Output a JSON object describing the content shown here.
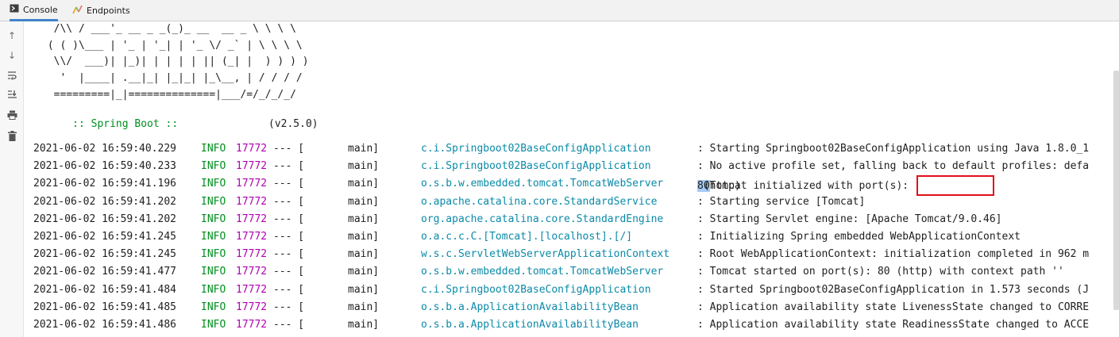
{
  "tabs": [
    {
      "label": "Console",
      "icon": "console-icon",
      "active": true
    },
    {
      "label": "Endpoints",
      "icon": "endpoints-icon",
      "active": false
    }
  ],
  "toolbar": [
    {
      "name": "scroll-up-icon",
      "glyph": "↑"
    },
    {
      "name": "scroll-down-icon",
      "glyph": "↓"
    },
    {
      "name": "soft-wrap-icon",
      "glyph": "⇉"
    },
    {
      "name": "scroll-to-end-icon",
      "glyph": "⇊"
    },
    {
      "name": "print-icon",
      "glyph": "⎙"
    },
    {
      "name": "trash-icon",
      "glyph": "🗑"
    }
  ],
  "banner": {
    "lines": [
      "  /\\\\ / ___'_ __ _ _(_)_ __  __ _ \\ \\ \\ \\",
      " ( ( )\\___ | '_ | '_| | '_ \\/ _` | \\ \\ \\ \\",
      "  \\\\/  ___)| |_)| | | | | || (_| |  ) ) ) )",
      "   '  |____| .__|_| |_|_| |_\\__, | / / / /",
      "  =========|_|==============|___/=/_/_/_/"
    ],
    "spring_label": " :: Spring Boot ::",
    "version": "(v2.5.0)"
  },
  "log": [
    {
      "ts": "2021-06-02 16:59:40.229",
      "level": "INFO",
      "pid": "17772",
      "sep": "--- [",
      "thread": "main]",
      "logger": "c.i.Springboot02BaseConfigApplication",
      "msg": ": Starting Springboot02BaseConfigApplication using Java 1.8.0_1"
    },
    {
      "ts": "2021-06-02 16:59:40.233",
      "level": "INFO",
      "pid": "17772",
      "sep": "--- [",
      "thread": "main]",
      "logger": "c.i.Springboot02BaseConfigApplication",
      "msg": ": No active profile set, falling back to default profiles: defa"
    },
    {
      "ts": "2021-06-02 16:59:41.196",
      "level": "INFO",
      "pid": "17772",
      "sep": "--- [",
      "thread": "main]",
      "logger": "o.s.b.w.embedded.tomcat.TomcatWebServer",
      "msg_pre": ": Tomcat initialized with port(s): ",
      "msg_sel": "80",
      "msg_post": " (http)"
    },
    {
      "ts": "2021-06-02 16:59:41.202",
      "level": "INFO",
      "pid": "17772",
      "sep": "--- [",
      "thread": "main]",
      "logger": "o.apache.catalina.core.StandardService",
      "msg": ": Starting service [Tomcat]"
    },
    {
      "ts": "2021-06-02 16:59:41.202",
      "level": "INFO",
      "pid": "17772",
      "sep": "--- [",
      "thread": "main]",
      "logger": "org.apache.catalina.core.StandardEngine",
      "msg": ": Starting Servlet engine: [Apache Tomcat/9.0.46]"
    },
    {
      "ts": "2021-06-02 16:59:41.245",
      "level": "INFO",
      "pid": "17772",
      "sep": "--- [",
      "thread": "main]",
      "logger": "o.a.c.c.C.[Tomcat].[localhost].[/]",
      "msg": ": Initializing Spring embedded WebApplicationContext"
    },
    {
      "ts": "2021-06-02 16:59:41.245",
      "level": "INFO",
      "pid": "17772",
      "sep": "--- [",
      "thread": "main]",
      "logger": "w.s.c.ServletWebServerApplicationContext",
      "msg": ": Root WebApplicationContext: initialization completed in 962 m"
    },
    {
      "ts": "2021-06-02 16:59:41.477",
      "level": "INFO",
      "pid": "17772",
      "sep": "--- [",
      "thread": "main]",
      "logger": "o.s.b.w.embedded.tomcat.TomcatWebServer",
      "msg": ": Tomcat started on port(s): 80 (http) with context path ''"
    },
    {
      "ts": "2021-06-02 16:59:41.484",
      "level": "INFO",
      "pid": "17772",
      "sep": "--- [",
      "thread": "main]",
      "logger": "c.i.Springboot02BaseConfigApplication",
      "msg": ": Started Springboot02BaseConfigApplication in 1.573 seconds (J"
    },
    {
      "ts": "2021-06-02 16:59:41.485",
      "level": "INFO",
      "pid": "17772",
      "sep": "--- [",
      "thread": "main]",
      "logger": "o.s.b.a.ApplicationAvailabilityBean",
      "msg": ": Application availability state LivenessState changed to CORRE"
    },
    {
      "ts": "2021-06-02 16:59:41.486",
      "level": "INFO",
      "pid": "17772",
      "sep": "--- [",
      "thread": "main]",
      "logger": "o.s.b.a.ApplicationAvailabilityBean",
      "msg": ": Application availability state ReadinessState changed to ACCE"
    }
  ],
  "colors": {
    "accent": "#4083c9",
    "info": "#008f1f",
    "pid": "#b000b0",
    "logger": "#0a8aa8",
    "highlight_box": "#e0101a",
    "selection": "#a6cbf4"
  }
}
